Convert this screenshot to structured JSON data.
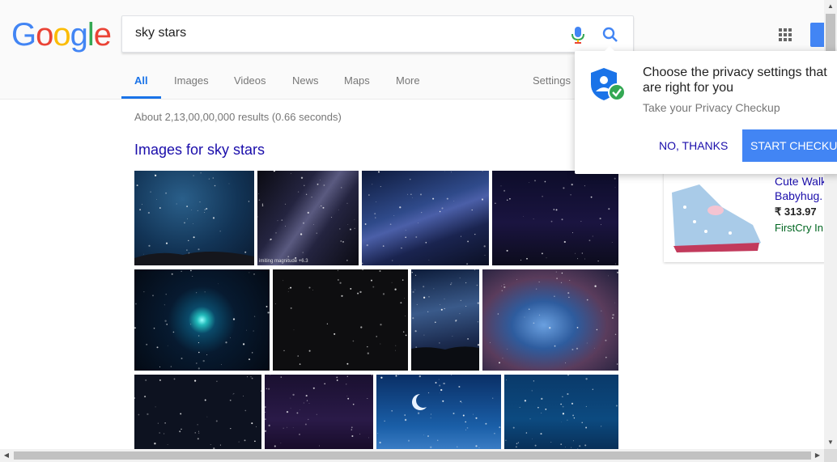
{
  "logo": {
    "letters": [
      "G",
      "o",
      "o",
      "g",
      "l",
      "e"
    ],
    "colors": [
      "#4285f4",
      "#ea4335",
      "#fbbc05",
      "#4285f4",
      "#34a853",
      "#ea4335"
    ]
  },
  "search": {
    "query": "sky stars"
  },
  "tabs": [
    {
      "label": "All",
      "active": true
    },
    {
      "label": "Images"
    },
    {
      "label": "Videos"
    },
    {
      "label": "News"
    },
    {
      "label": "Maps"
    },
    {
      "label": "More"
    },
    {
      "label": "Settings"
    }
  ],
  "results": {
    "stats": "About 2,13,00,00,000 results (0.66 seconds)",
    "images_heading": "Images for sky stars",
    "image_caption": "imiting magnitude +6.3"
  },
  "privacy": {
    "title": "Choose the privacy settings that are right for you",
    "subtitle": "Take your Privacy Checkup",
    "no_thanks": "NO, THANKS",
    "start": "START CHECKUP"
  },
  "shopping": {
    "title": "Cute Walk",
    "subtitle": "Babyhug.",
    "price": "₹ 313.97",
    "seller": "FirstCry In"
  },
  "colors": {
    "accent": "#1a73e8",
    "link": "#1a0dab",
    "button": "#4285f4",
    "green": "#006621"
  }
}
